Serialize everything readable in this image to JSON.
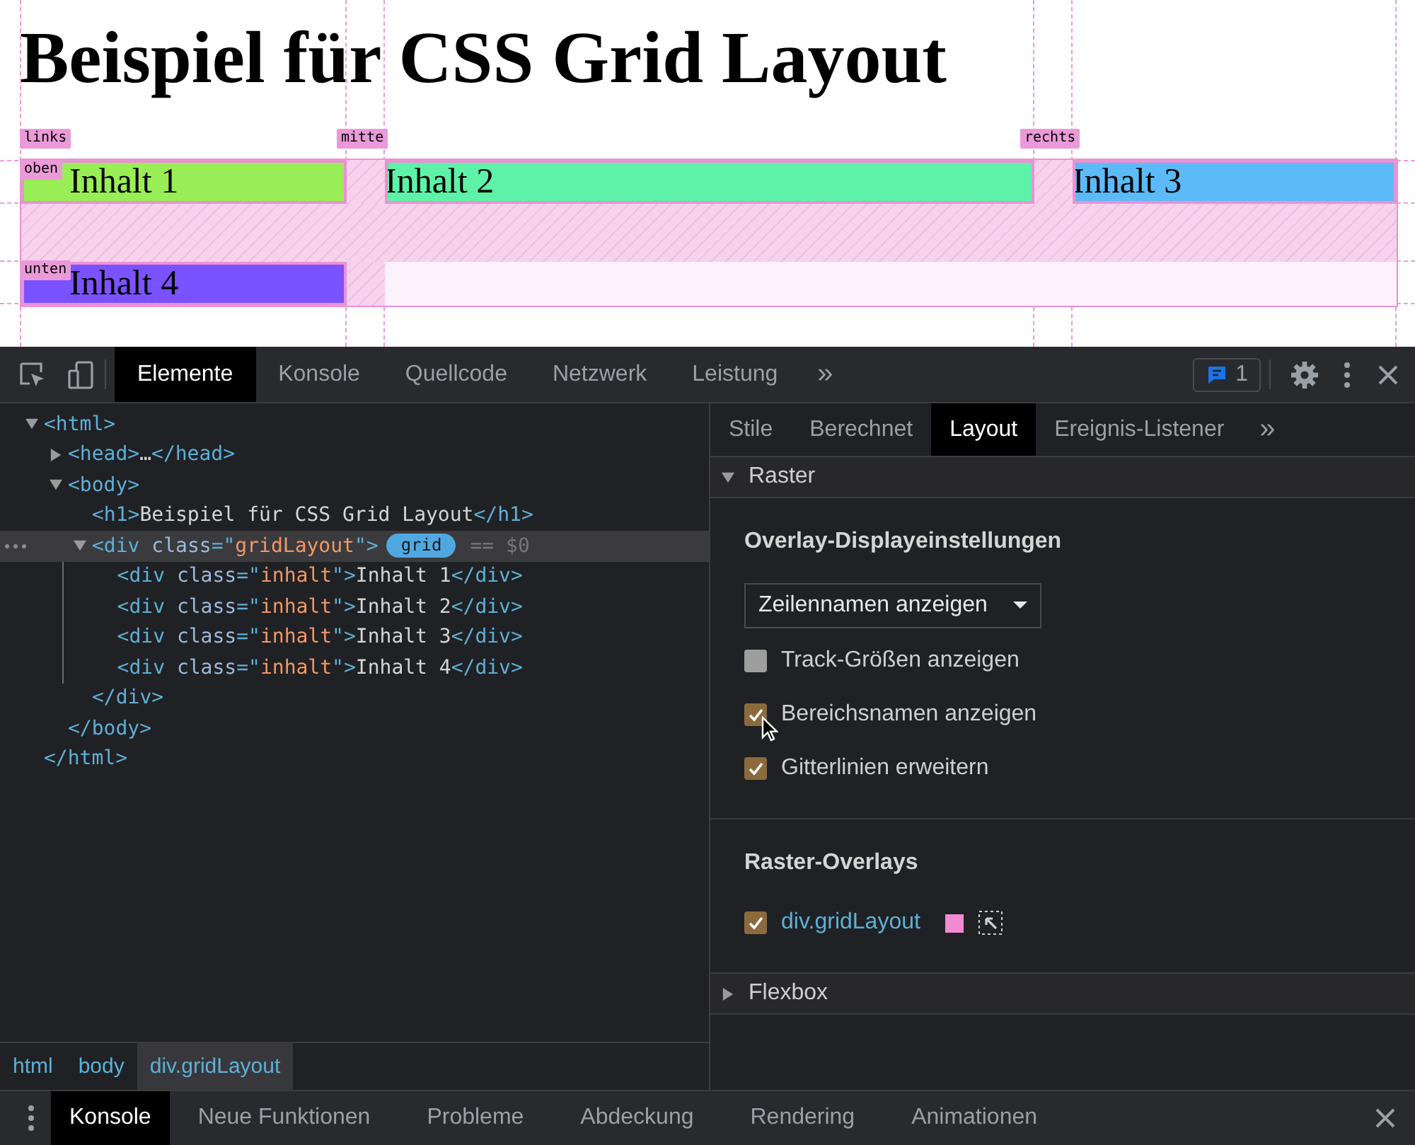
{
  "page": {
    "heading": "Beispiel für CSS Grid Layout",
    "column_names": [
      "links",
      "mitte",
      "rechts"
    ],
    "row_names": [
      "oben",
      "unten"
    ],
    "items": [
      {
        "text": "Inhalt 1",
        "color": "#99ee55"
      },
      {
        "text": "Inhalt 2",
        "color": "#5ef2a8"
      },
      {
        "text": "Inhalt 3",
        "color": "#5cbaf8"
      },
      {
        "text": "Inhalt 4",
        "color": "#7a52ff"
      }
    ]
  },
  "devtools": {
    "tabs": [
      {
        "label": "Elemente",
        "selected": true
      },
      {
        "label": "Konsole",
        "selected": false
      },
      {
        "label": "Quellcode",
        "selected": false
      },
      {
        "label": "Netzwerk",
        "selected": false
      },
      {
        "label": "Leistung",
        "selected": false
      }
    ],
    "more_tabs": "»",
    "issues_count": "1",
    "elements_tree": [
      {
        "open": [
          {
            "kind": "tag",
            "text": "<html>"
          }
        ],
        "expanded": true,
        "selected": false,
        "close": [
          {
            "kind": "tag",
            "text": "</html>"
          }
        ],
        "children": [
          {
            "open": [
              {
                "kind": "tag",
                "text": "<head>"
              },
              {
                "kind": "text",
                "text": "…"
              },
              {
                "kind": "tag",
                "text": "</head>"
              }
            ],
            "expanded": false,
            "selected": false
          },
          {
            "open": [
              {
                "kind": "tag",
                "text": "<body>"
              }
            ],
            "expanded": true,
            "selected": false,
            "close": [
              {
                "kind": "tag",
                "text": "</body>"
              }
            ],
            "children": [
              {
                "open": [
                  {
                    "kind": "tag",
                    "text": "<h1>"
                  },
                  {
                    "kind": "text",
                    "text": "Beispiel für CSS Grid Layout"
                  },
                  {
                    "kind": "tag",
                    "text": "</h1>"
                  }
                ],
                "selected": false
              },
              {
                "open": [
                  {
                    "kind": "tag",
                    "text": "<div "
                  },
                  {
                    "kind": "attr",
                    "text": "class"
                  },
                  {
                    "kind": "tag",
                    "text": "=\""
                  },
                  {
                    "kind": "value",
                    "text": "gridLayout"
                  },
                  {
                    "kind": "tag",
                    "text": "\">"
                  }
                ],
                "expanded": true,
                "selected": true,
                "badge": "grid",
                "ref": "== $0",
                "close": [
                  {
                    "kind": "tag",
                    "text": "</div>"
                  }
                ],
                "children": [
                  {
                    "open": [
                      {
                        "kind": "tag",
                        "text": "<div "
                      },
                      {
                        "kind": "attr",
                        "text": "class"
                      },
                      {
                        "kind": "tag",
                        "text": "=\""
                      },
                      {
                        "kind": "value",
                        "text": "inhalt"
                      },
                      {
                        "kind": "tag",
                        "text": "\">"
                      },
                      {
                        "kind": "text",
                        "text": "Inhalt 1"
                      },
                      {
                        "kind": "tag",
                        "text": "</div>"
                      }
                    ],
                    "selected": false
                  },
                  {
                    "open": [
                      {
                        "kind": "tag",
                        "text": "<div "
                      },
                      {
                        "kind": "attr",
                        "text": "class"
                      },
                      {
                        "kind": "tag",
                        "text": "=\""
                      },
                      {
                        "kind": "value",
                        "text": "inhalt"
                      },
                      {
                        "kind": "tag",
                        "text": "\">"
                      },
                      {
                        "kind": "text",
                        "text": "Inhalt 2"
                      },
                      {
                        "kind": "tag",
                        "text": "</div>"
                      }
                    ],
                    "selected": false
                  },
                  {
                    "open": [
                      {
                        "kind": "tag",
                        "text": "<div "
                      },
                      {
                        "kind": "attr",
                        "text": "class"
                      },
                      {
                        "kind": "tag",
                        "text": "=\""
                      },
                      {
                        "kind": "value",
                        "text": "inhalt"
                      },
                      {
                        "kind": "tag",
                        "text": "\">"
                      },
                      {
                        "kind": "text",
                        "text": "Inhalt 3"
                      },
                      {
                        "kind": "tag",
                        "text": "</div>"
                      }
                    ],
                    "selected": false
                  },
                  {
                    "open": [
                      {
                        "kind": "tag",
                        "text": "<div "
                      },
                      {
                        "kind": "attr",
                        "text": "class"
                      },
                      {
                        "kind": "tag",
                        "text": "=\""
                      },
                      {
                        "kind": "value",
                        "text": "inhalt"
                      },
                      {
                        "kind": "tag",
                        "text": "\">"
                      },
                      {
                        "kind": "text",
                        "text": "Inhalt 4"
                      },
                      {
                        "kind": "tag",
                        "text": "</div>"
                      }
                    ],
                    "selected": false
                  }
                ]
              }
            ]
          }
        ]
      }
    ],
    "breadcrumbs": [
      {
        "label": "html",
        "selected": false
      },
      {
        "label": "body",
        "selected": false
      },
      {
        "label": "div.gridLayout",
        "selected": true
      }
    ],
    "sidebar_tabs": [
      {
        "label": "Stile",
        "selected": false
      },
      {
        "label": "Berechnet",
        "selected": false
      },
      {
        "label": "Layout",
        "selected": true
      },
      {
        "label": "Ereignis-Listener",
        "selected": false
      }
    ],
    "sidebar_more": "»",
    "grid_section": {
      "title": "Raster",
      "expanded": true,
      "settings_heading": "Overlay-Displayeinstellungen",
      "dropdown_value": "Zeilennamen anzeigen",
      "options": [
        {
          "label": "Track-Größen anzeigen",
          "checked": false
        },
        {
          "label": "Bereichsnamen anzeigen",
          "checked": true
        },
        {
          "label": "Gitterlinien erweitern",
          "checked": true
        }
      ],
      "overlays_heading": "Raster-Overlays",
      "overlays": [
        {
          "label": "div.gridLayout",
          "checked": true,
          "color": "#f28ad2"
        }
      ]
    },
    "flexbox_section": {
      "title": "Flexbox",
      "expanded": false
    },
    "drawer_tabs": [
      {
        "label": "Konsole",
        "selected": true
      },
      {
        "label": "Neue Funktionen",
        "selected": false
      },
      {
        "label": "Probleme",
        "selected": false
      },
      {
        "label": "Abdeckung",
        "selected": false
      },
      {
        "label": "Rendering",
        "selected": false
      },
      {
        "label": "Animationen",
        "selected": false
      }
    ]
  }
}
